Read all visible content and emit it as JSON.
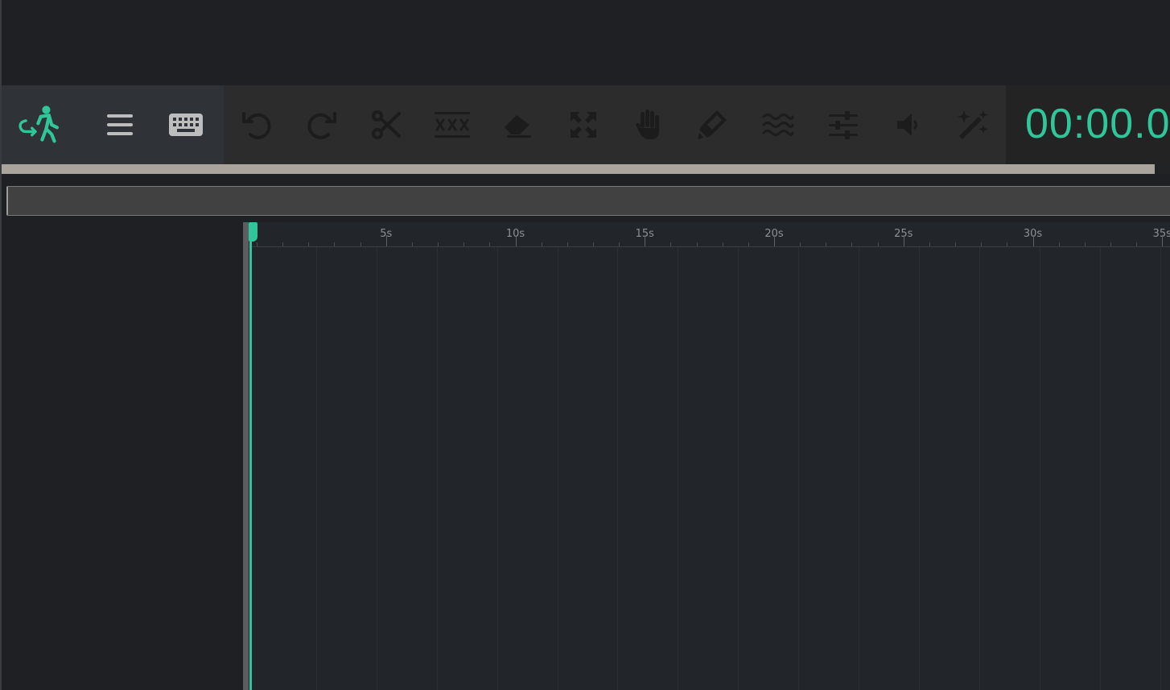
{
  "colors": {
    "accent": "#2fc79a",
    "icon_dark": "#1c1c1c",
    "icon_light": "#bdbdbd",
    "background": "#1f2024"
  },
  "toolbar": {
    "main_tools": [
      {
        "name": "exit-icon",
        "active": true
      },
      {
        "name": "menu-icon",
        "active": false
      },
      {
        "name": "keyboard-icon",
        "active": false
      }
    ],
    "edit_tools": [
      {
        "name": "undo-icon"
      },
      {
        "name": "redo-icon"
      },
      {
        "name": "scissors-icon"
      },
      {
        "name": "strikethrough-icon"
      },
      {
        "name": "eraser-icon"
      },
      {
        "name": "expand-icon"
      },
      {
        "name": "hand-icon"
      },
      {
        "name": "highlighter-icon"
      },
      {
        "name": "waves-icon"
      },
      {
        "name": "sliders-icon"
      },
      {
        "name": "volume-icon"
      },
      {
        "name": "magic-wand-icon"
      }
    ]
  },
  "timer": {
    "value": "00:00.0"
  },
  "progress": {
    "fraction": 0.987
  },
  "timeline": {
    "ruler_labels": [
      "5s",
      "10s",
      "15s",
      "20s",
      "25s",
      "30s",
      "35s"
    ],
    "playhead_seconds": 0
  }
}
